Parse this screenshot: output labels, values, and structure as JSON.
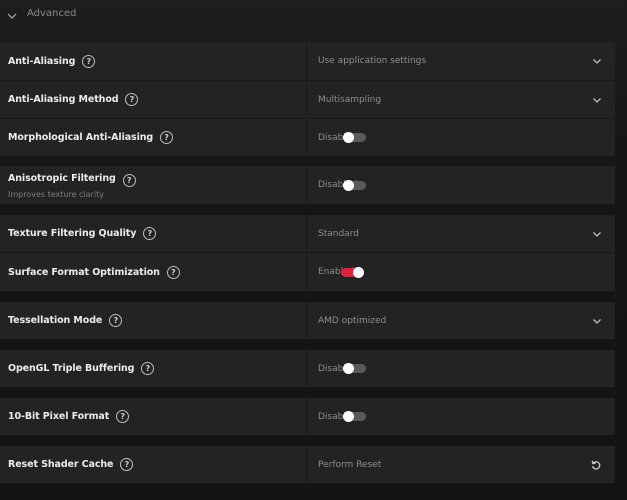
{
  "section": {
    "title": "Advanced",
    "expanded": true
  },
  "settings": [
    {
      "label": "Anti-Aliasing",
      "value": "Use application settings",
      "control": "dropdown"
    },
    {
      "label": "Anti-Aliasing Method",
      "value": "Multisampling",
      "control": "dropdown"
    },
    {
      "label": "Morphological Anti-Aliasing",
      "value": "Disabled",
      "control": "toggle",
      "on": false
    },
    {
      "label": "Anisotropic Filtering",
      "sublabel": "Improves texture clarity",
      "value": "Disabled",
      "control": "toggle",
      "on": false
    },
    {
      "label": "Texture Filtering Quality",
      "value": "Standard",
      "control": "dropdown"
    },
    {
      "label": "Surface Format Optimization",
      "value": "Enabled",
      "control": "toggle",
      "on": true
    },
    {
      "label": "Tessellation Mode",
      "value": "AMD optimized",
      "control": "dropdown"
    },
    {
      "label": "OpenGL Triple Buffering",
      "value": "Disabled",
      "control": "toggle",
      "on": false
    },
    {
      "label": "10-Bit Pixel Format",
      "value": "Disabled",
      "control": "toggle",
      "on": false
    },
    {
      "label": "Reset Shader Cache",
      "value": "Perform Reset",
      "control": "reset"
    }
  ],
  "help_glyph": "?",
  "colors": {
    "accent": "#e0213b",
    "row_bg": "#232323",
    "label": "#ececec",
    "value": "#8e8e8e"
  }
}
